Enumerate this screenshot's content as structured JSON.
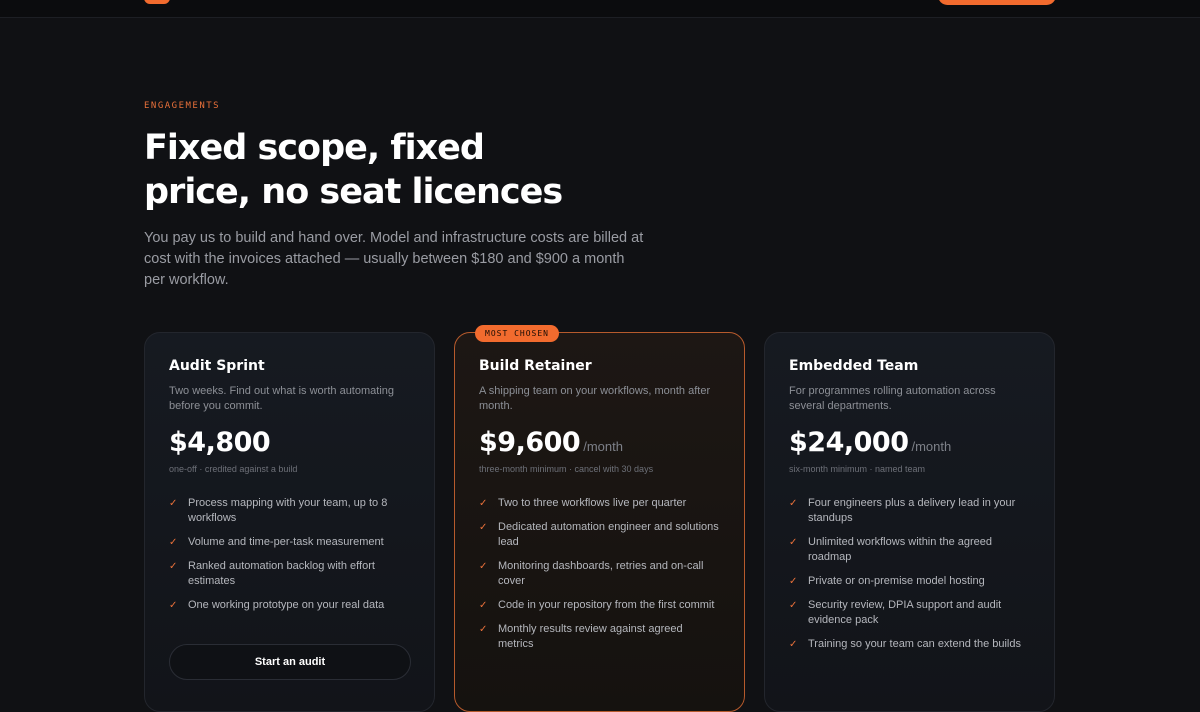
{
  "hero": {
    "eyebrow": "ENGAGEMENTS",
    "headline": "Fixed scope, fixed price, no seat licences",
    "subcopy": "You pay us to build and hand over. Model and infrastructure costs are billed at cost with the invoices attached — usually between $180 and $900 a month per workflow."
  },
  "plans": [
    {
      "title": "Audit Sprint",
      "description": "Two weeks. Find out what is worth automating before you commit.",
      "price": "$4,800",
      "unit": "",
      "note": "one-off · credited against a build",
      "features": [
        "Process mapping with your team, up to 8 workflows",
        "Volume and time-per-task measurement",
        "Ranked automation backlog with effort estimates",
        "One working prototype on your real data"
      ],
      "cta": "Start an audit"
    },
    {
      "badge": "MOST CHOSEN",
      "title": "Build Retainer",
      "description": "A shipping team on your workflows, month after month.",
      "price": "$9,600",
      "unit": "/month",
      "note": "three-month minimum · cancel with 30 days",
      "features": [
        "Two to three workflows live per quarter",
        "Dedicated automation engineer and solutions lead",
        "Monitoring dashboards, retries and on-call cover",
        "Code in your repository from the first commit",
        "Monthly results review against agreed metrics"
      ]
    },
    {
      "title": "Embedded Team",
      "description": "For programmes rolling automation across several departments.",
      "price": "$24,000",
      "unit": "/month",
      "note": "six-month minimum · named team",
      "features": [
        "Four engineers plus a delivery lead in your standups",
        "Unlimited workflows within the agreed roadmap",
        "Private or on-premise model hosting",
        "Security review, DPIA support and audit evidence pack",
        "Training so your team can extend the builds"
      ]
    }
  ],
  "icons": {
    "check": "✓"
  },
  "colors": {
    "accent": "#f26b2e",
    "background": "#101114"
  }
}
